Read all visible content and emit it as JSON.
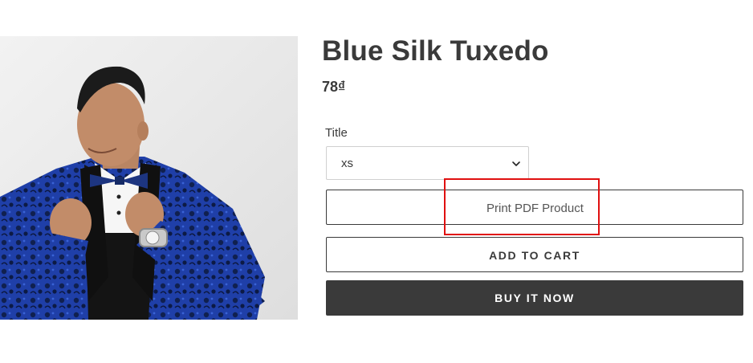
{
  "product": {
    "title": "Blue Silk Tuxedo",
    "price": "78₫",
    "image_alt": "man in blue floral silk tuxedo adjusting bow tie"
  },
  "variant": {
    "label": "Title",
    "selected": "xs"
  },
  "buttons": {
    "print_pdf": "Print PDF Product",
    "add_to_cart": "ADD TO CART",
    "buy_now": "BUY IT NOW"
  },
  "colors": {
    "text": "#3a3a3a",
    "buy_button_bg": "#3a3a3a",
    "highlight": "#e01010"
  }
}
